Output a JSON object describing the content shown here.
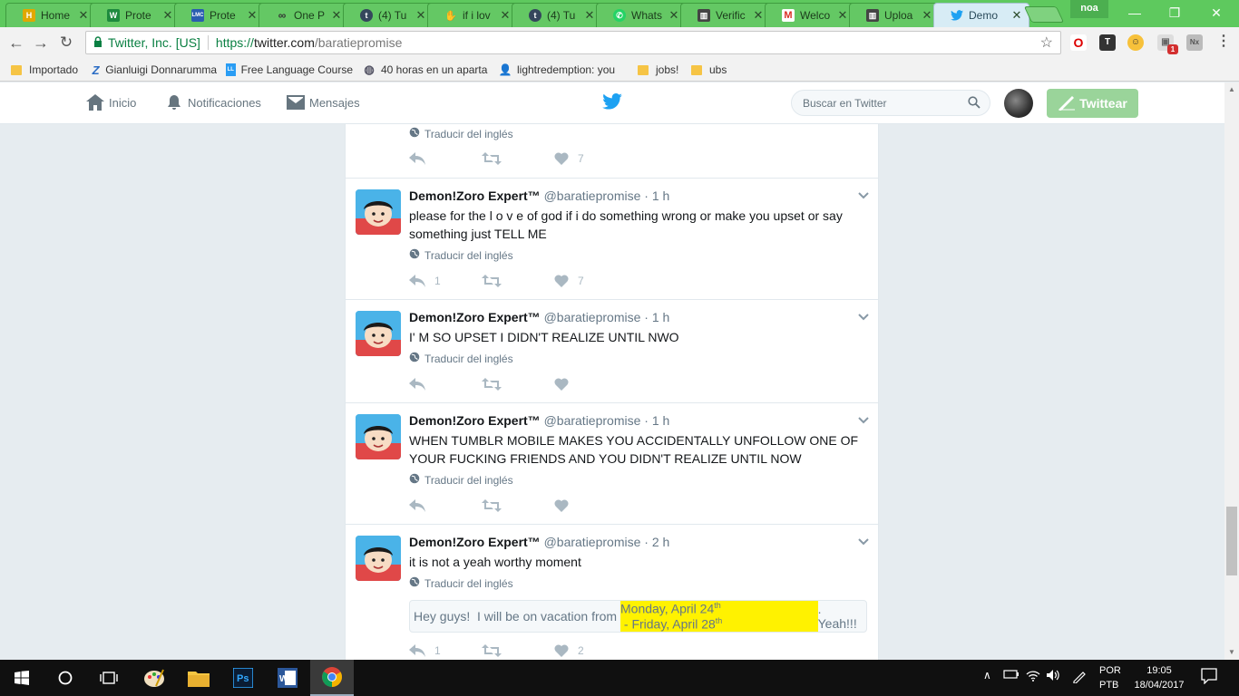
{
  "browser": {
    "tabs": [
      {
        "label": "Home",
        "favicon": "H",
        "fav_color": "#e0a800"
      },
      {
        "label": "Prote",
        "favicon": "W",
        "fav_color": "#1e8a3e"
      },
      {
        "label": "Prote",
        "favicon": "LMC",
        "fav_color": "#2a5db0"
      },
      {
        "label": "One P",
        "favicon": "∞",
        "fav_color": "#333333"
      },
      {
        "label": "(4) Tu",
        "favicon": "t",
        "fav_color": "#35465c"
      },
      {
        "label": "if i lov",
        "favicon": "✋",
        "fav_color": "#888888"
      },
      {
        "label": "(4) Tu",
        "favicon": "t",
        "fav_color": "#35465c"
      },
      {
        "label": "Whats",
        "favicon": "✆",
        "fav_color": "#25d366"
      },
      {
        "label": "Verific",
        "favicon": "▥",
        "fav_color": "#444444"
      },
      {
        "label": "Welco",
        "favicon": "M",
        "fav_color": "#d93025"
      },
      {
        "label": "Uploa",
        "favicon": "▥",
        "fav_color": "#444444"
      },
      {
        "label": "Demo",
        "favicon": "🐦",
        "fav_color": "#1da1f2"
      }
    ],
    "profile_name": "noa",
    "window_controls": {
      "minimize": "—",
      "maximize": "❐",
      "close": "✕"
    },
    "security_label": "Twitter, Inc. [US]",
    "url_protocol": "https://",
    "url_host": "twitter.com",
    "url_path": "/baratiepromise",
    "extension_badge": "1",
    "bookmarks": [
      {
        "label": "Importado",
        "icon": "folder-icon"
      },
      {
        "label": "Gianluigi Donnarumma",
        "icon": "z-icon"
      },
      {
        "label": "Free Language Course",
        "icon": "lang-icon"
      },
      {
        "label": "40 horas en un aparta",
        "icon": "globe-icon"
      },
      {
        "label": "lightredemption: you",
        "icon": "user-icon"
      },
      {
        "label": "jobs!",
        "icon": "folder-icon"
      },
      {
        "label": "ubs",
        "icon": "folder-icon"
      }
    ]
  },
  "twitter_nav": {
    "home": "Inicio",
    "notifications": "Notificaciones",
    "messages": "Mensajes",
    "search_placeholder": "Buscar en Twitter",
    "tweet_button": "Twittear"
  },
  "timeline": {
    "partial_tweet": {
      "translate": "Traducir del inglés",
      "likes": "7"
    },
    "tweets": [
      {
        "name": "Demon!Zoro Expert™",
        "handle": "@baratiepromise",
        "time": "1 h",
        "text": "please for the  l  o  v e of god if i do something wrong or make you upset or say something just TELL ME",
        "translate": "Traducir del inglés",
        "replies": "1",
        "likes": "7"
      },
      {
        "name": "Demon!Zoro Expert™",
        "handle": "@baratiepromise",
        "time": "1 h",
        "text": "I' M SO UPSET I DIDN'T REALIZE UNTIL NWO",
        "translate": "Traducir del inglés",
        "replies": "",
        "likes": ""
      },
      {
        "name": "Demon!Zoro Expert™",
        "handle": "@baratiepromise",
        "time": "1 h",
        "text": "WHEN TUMBLR MOBILE MAKES YOU ACCIDENTALLY UNFOLLOW ONE OF YOUR FUCKING FRIENDS AND YOU DIDN'T REALIZE UNTIL NOW",
        "translate": "Traducir del inglés",
        "replies": "",
        "likes": ""
      },
      {
        "name": "Demon!Zoro Expert™",
        "handle": "@baratiepromise",
        "time": "2 h",
        "text": "it is not a yeah worthy moment",
        "translate": "Traducir del inglés",
        "quote_before": "Hey guys!  I will be on vacation from ",
        "quote_highlight_1": "Monday, April 24",
        "quote_highlight_sup_1": "th",
        "quote_highlight_2": " - Friday, April 28",
        "quote_highlight_sup_2": "th",
        "quote_after": ". Yeah!!!",
        "replies": "1",
        "likes": "2"
      }
    ],
    "time_separator": "·"
  },
  "taskbar": {
    "language_line1": "POR",
    "language_line2": "PTB",
    "time": "19:05",
    "date": "18/04/2017"
  },
  "colors": {
    "tabstrip": "#5ec95e",
    "twitter_blue": "#1da1f2",
    "tweet_button": "#9ad49a",
    "highlight": "#fff200"
  }
}
